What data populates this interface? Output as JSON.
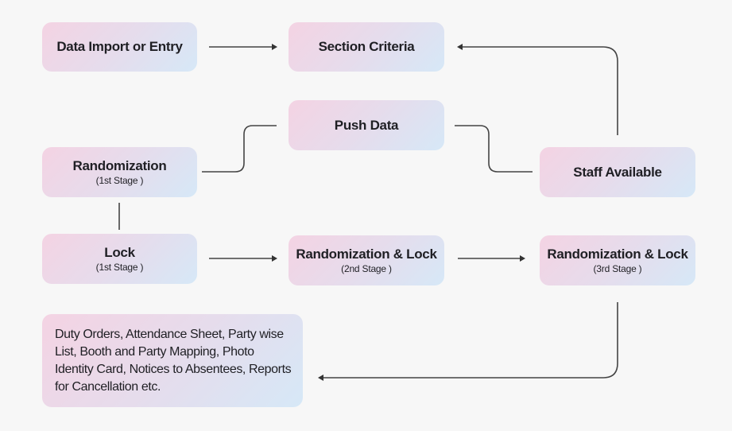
{
  "diagram": {
    "nodes": {
      "data_import": {
        "title": "Data Import or Entry"
      },
      "section_criteria": {
        "title": "Section Criteria"
      },
      "push_data": {
        "title": "Push Data"
      },
      "randomization_1": {
        "title": "Randomization",
        "subtitle": "(1st Stage )"
      },
      "staff_available": {
        "title": "Staff Available"
      },
      "lock_1": {
        "title": "Lock",
        "subtitle": "(1st Stage )"
      },
      "randomization_lock_2": {
        "title": "Randomization & Lock",
        "subtitle": "(2nd Stage )"
      },
      "randomization_lock_3": {
        "title": "Randomization & Lock",
        "subtitle": "(3rd Stage )"
      },
      "outputs": {
        "text": "Duty Orders, Attendance Sheet, Party wise List, Booth and Party Mapping, Photo Identity Card, Notices to Absentees, Reports for Cancellation etc."
      }
    },
    "edges": [
      {
        "from": "data_import",
        "to": "section_criteria",
        "arrow": true
      },
      {
        "from": "staff_available",
        "to": "section_criteria",
        "arrow": true
      },
      {
        "from": "randomization_1",
        "to": "push_data",
        "arrow": false
      },
      {
        "from": "push_data",
        "to": "staff_available",
        "arrow": false
      },
      {
        "from": "randomization_1",
        "to": "lock_1",
        "arrow": false
      },
      {
        "from": "lock_1",
        "to": "randomization_lock_2",
        "arrow": true
      },
      {
        "from": "randomization_lock_2",
        "to": "randomization_lock_3",
        "arrow": true
      },
      {
        "from": "randomization_lock_3",
        "to": "outputs",
        "arrow": true
      }
    ],
    "colors": {
      "background": "#f7f7f7",
      "node_gradient_start": "#f4d3e3",
      "node_gradient_end": "#d6e8f7",
      "connector": "#444444",
      "text": "#1f1f24"
    }
  }
}
